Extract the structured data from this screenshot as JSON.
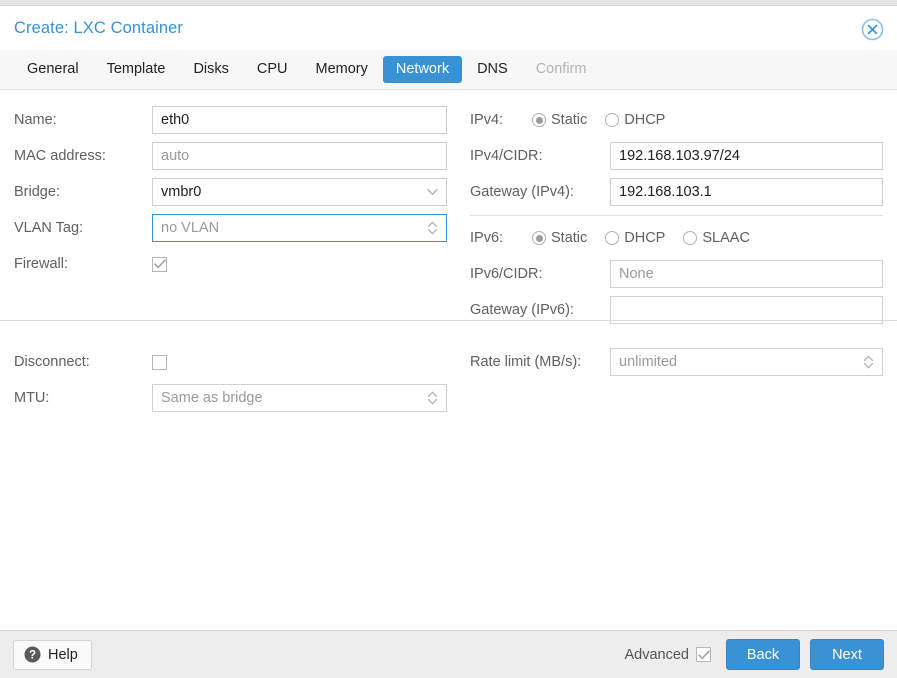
{
  "dialog": {
    "title": "Create: LXC Container",
    "close_icon": "close-circle-icon"
  },
  "tabs": [
    {
      "label": "General",
      "state": "normal"
    },
    {
      "label": "Template",
      "state": "normal"
    },
    {
      "label": "Disks",
      "state": "normal"
    },
    {
      "label": "CPU",
      "state": "normal"
    },
    {
      "label": "Memory",
      "state": "normal"
    },
    {
      "label": "Network",
      "state": "active"
    },
    {
      "label": "DNS",
      "state": "normal"
    },
    {
      "label": "Confirm",
      "state": "disabled"
    }
  ],
  "left": {
    "name": {
      "label": "Name:",
      "value": "eth0"
    },
    "mac": {
      "label": "MAC address:",
      "placeholder": "auto"
    },
    "bridge": {
      "label": "Bridge:",
      "value": "vmbr0"
    },
    "vlan": {
      "label": "VLAN Tag:",
      "placeholder": "no VLAN"
    },
    "firewall": {
      "label": "Firewall:",
      "checked": true
    },
    "disconnect": {
      "label": "Disconnect:",
      "checked": false
    },
    "mtu": {
      "label": "MTU:",
      "placeholder": "Same as bridge"
    }
  },
  "right": {
    "ipv4": {
      "label": "IPv4:",
      "options": [
        "Static",
        "DHCP"
      ],
      "selected": "Static"
    },
    "ipv4_cidr": {
      "label": "IPv4/CIDR:",
      "value": "192.168.103.97/24"
    },
    "ipv4_gateway": {
      "label": "Gateway (IPv4):",
      "value": "192.168.103.1"
    },
    "ipv6": {
      "label": "IPv6:",
      "options": [
        "Static",
        "DHCP",
        "SLAAC"
      ],
      "selected": "Static"
    },
    "ipv6_cidr": {
      "label": "IPv6/CIDR:",
      "placeholder": "None"
    },
    "ipv6_gateway": {
      "label": "Gateway (IPv6):",
      "value": ""
    },
    "rate_limit": {
      "label": "Rate limit (MB/s):",
      "placeholder": "unlimited"
    }
  },
  "footer": {
    "help": {
      "label": "Help",
      "icon": "help-circle-icon"
    },
    "advanced": {
      "label": "Advanced",
      "checked": true
    },
    "back": "Back",
    "next": "Next"
  },
  "colors": {
    "accent": "#3892d4",
    "tab_bar_bg": "#f7f7f7",
    "footer_bg": "#ededed",
    "label_text": "#606060",
    "value_text": "#202020",
    "placeholder_text": "#9a9a9a"
  }
}
